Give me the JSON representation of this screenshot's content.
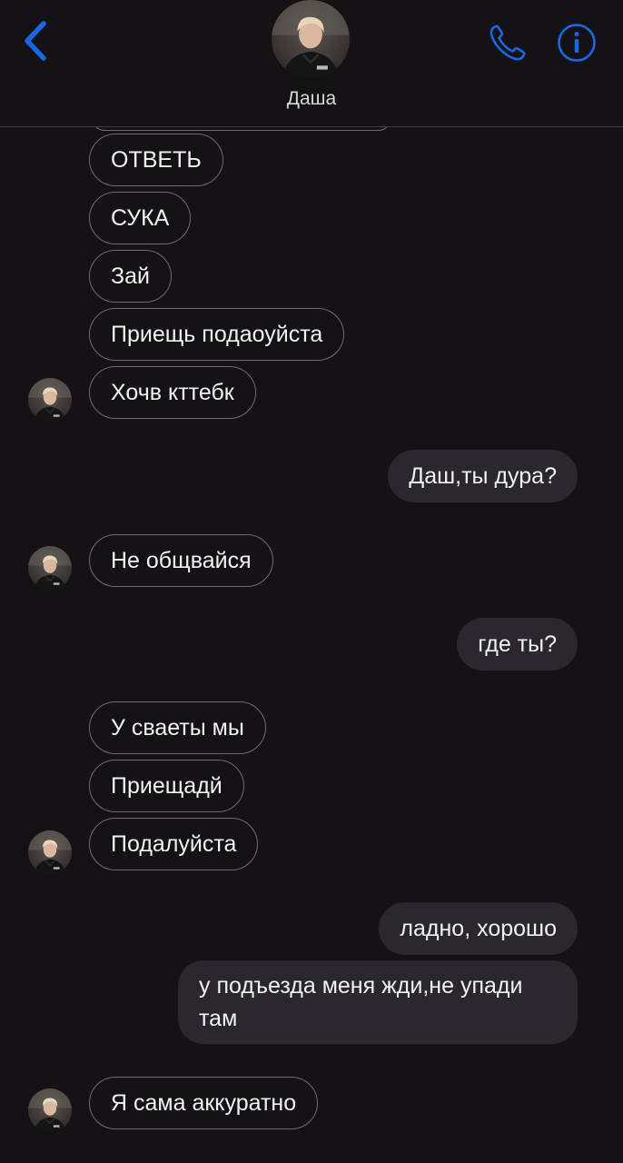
{
  "header": {
    "contact_name": "Даша",
    "back_icon": "chevron-left-icon",
    "call_icon": "phone-icon",
    "info_icon": "info-icon",
    "accent": "#1668e8"
  },
  "messages": [
    {
      "side": "incoming",
      "text": "ОТВЕТЬ"
    },
    {
      "side": "incoming",
      "text": "СУКА"
    },
    {
      "side": "incoming",
      "text": "Зай"
    },
    {
      "side": "incoming",
      "text": "Приещь подаоуйста"
    },
    {
      "side": "incoming",
      "text": "Хочв кттебк"
    },
    {
      "side": "outgoing",
      "text": "Даш,ты дура?"
    },
    {
      "side": "incoming",
      "text": "Не общвайся"
    },
    {
      "side": "outgoing",
      "text": "где ты?"
    },
    {
      "side": "incoming",
      "text": "У сваеты мы"
    },
    {
      "side": "incoming",
      "text": "Приещадй"
    },
    {
      "side": "incoming",
      "text": "Подалуйста"
    },
    {
      "side": "outgoing",
      "text": "ладно, хорошо"
    },
    {
      "side": "outgoing",
      "text": "у подъезда меня жди,не упади там"
    },
    {
      "side": "incoming",
      "text": "Я сама аккуратно"
    }
  ],
  "colors": {
    "background": "#141215",
    "incoming_border": "#6c6c70",
    "outgoing_bubble": "#2a282d"
  }
}
